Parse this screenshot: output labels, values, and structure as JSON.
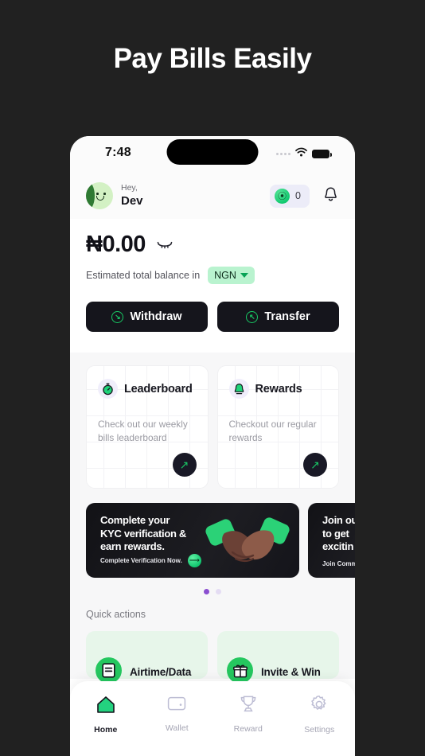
{
  "promo": {
    "title": "Pay Bills Easily"
  },
  "statusbar": {
    "time": "7:48",
    "signal_icon": "signal-dots-icon",
    "wifi_icon": "wifi-icon",
    "battery_icon": "battery-full-icon"
  },
  "header": {
    "avatar_icon": "avatar-smiley-icon",
    "greeting": "Hey,",
    "username": "Dev",
    "points_icon": "leaf-token-icon",
    "points_count": "0",
    "bell_icon": "bell-icon"
  },
  "balance": {
    "amount": "₦0.00",
    "hide_icon": "eye-off-icon",
    "subtitle": "Estimated total balance in",
    "currency": "NGN",
    "currency_caret_icon": "chevron-down-icon",
    "currency_pill_color": "#b9f3cf"
  },
  "actions": [
    {
      "label": "Withdraw",
      "icon": "arrow-down-right-circle-icon"
    },
    {
      "label": "Transfer",
      "icon": "arrow-up-right-circle-icon"
    }
  ],
  "info_cards": [
    {
      "title": "Leaderboard",
      "icon": "stopwatch-icon",
      "desc": "Check out our weekly bills leaderboard",
      "arrow_icon": "arrow-up-right-icon"
    },
    {
      "title": "Rewards",
      "icon": "bell-filled-icon",
      "desc": "Checkout our regular rewards",
      "arrow_icon": "arrow-up-right-icon"
    }
  ],
  "banners": [
    {
      "title": "Complete your\nKYC verification &\nearn rewards.",
      "cta": "Complete Verification Now.",
      "cta_icon": "arrow-right-circle-icon",
      "art_icon": "handshake-icon"
    },
    {
      "title": "Join ou\nto get\nexcitin",
      "cta": "Join Commun",
      "cta_icon": "",
      "art_icon": ""
    }
  ],
  "carousel": {
    "dots": 2,
    "active": 0,
    "active_color": "#8b4fd0",
    "inactive_color": "#e4dcf3"
  },
  "quick_actions": {
    "label": "Quick actions",
    "items": [
      {
        "label": "Airtime/Data",
        "icon": "bill-document-icon"
      },
      {
        "label": "Invite & Win",
        "icon": "gift-icon"
      }
    ]
  },
  "bottom_nav": [
    {
      "label": "Home",
      "icon": "home-icon",
      "active": true
    },
    {
      "label": "Wallet",
      "icon": "wallet-icon",
      "active": false
    },
    {
      "label": "Reward",
      "icon": "trophy-icon",
      "active": false
    },
    {
      "label": "Settings",
      "icon": "gear-icon",
      "active": false
    }
  ]
}
